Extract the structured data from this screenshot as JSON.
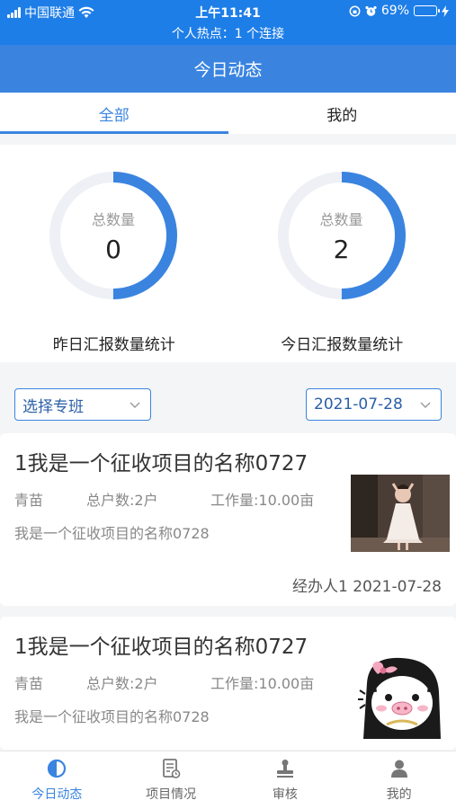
{
  "status_bar": {
    "carrier": "中国联通",
    "time": "上午11:41",
    "battery": "69%",
    "battery_level": 0.69,
    "hotspot": "个人热点：1 个连接"
  },
  "header": {
    "title": "今日动态"
  },
  "tabs": [
    {
      "label": "全部",
      "active": true
    },
    {
      "label": "我的",
      "active": false
    }
  ],
  "stats": [
    {
      "label": "总数量",
      "value": "0",
      "caption": "昨日汇报数量统计",
      "ring_fraction": 0.5
    },
    {
      "label": "总数量",
      "value": "2",
      "caption": "今日汇报数量统计",
      "ring_fraction": 0.5
    }
  ],
  "filter": {
    "class_select": "选择专班",
    "date_select": "2021-07-28"
  },
  "cards": [
    {
      "title": "1我是一个征收项目的名称0727",
      "crop": "青苗",
      "households": "总户数:2户",
      "workload": "工作量:10.00亩",
      "description": "我是一个征收项目的名称0728",
      "footer": "经办人1 2021-07-28"
    },
    {
      "title": "1我是一个征收项目的名称0727",
      "crop": "青苗",
      "households": "总户数:2户",
      "workload": "工作量:10.00亩",
      "description": "我是一个征收项目的名称0728"
    }
  ],
  "tabbar": [
    {
      "label": "今日动态",
      "icon": "pie-chart-icon",
      "active": true
    },
    {
      "label": "项目情况",
      "icon": "document-icon",
      "active": false
    },
    {
      "label": "审核",
      "icon": "stamp-icon",
      "active": false
    },
    {
      "label": "我的",
      "icon": "user-icon",
      "active": false
    }
  ],
  "colors": {
    "accent": "#3a84e0",
    "status_bar": "#1e7ee8",
    "ring_track": "#eef0f5"
  }
}
